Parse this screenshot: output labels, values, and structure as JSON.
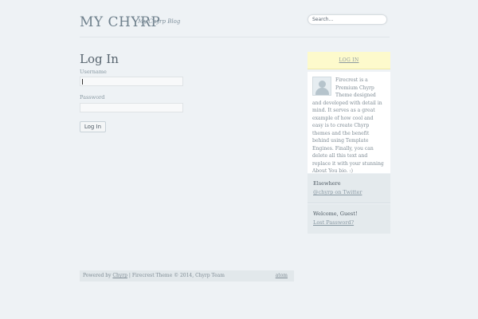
{
  "header": {
    "site_title": "MY CHYRP",
    "site_description": "My Chyrp Blog",
    "search_placeholder": "Search..."
  },
  "main": {
    "title": "Log In",
    "username_label": "Username",
    "username_value": "",
    "password_label": "Password",
    "password_value": "",
    "login_button": "Log In"
  },
  "sidebar": {
    "login_tab": "LOG IN",
    "about_text": "Firecrest is a Premium Chyrp Theme designed and developed with detail in mind. It serves as a great example of how cool and easy is to create Chyrp themes and the benefit behind using Template Engines. Finally, you can delete all this text and replace it with your stunning About You bio. :)",
    "elsewhere_title": "Elsewhere",
    "elsewhere_link": "@chyrp on Twitter",
    "welcome_title": "Welcome, Guest!",
    "lost_password_link": "Lost Password?"
  },
  "footer": {
    "powered_by": "Powered by",
    "chyrp_link": "Chyrp",
    "theme_credit": "| Firecrest Theme © 2014, Chyrp Team",
    "atom_link": "atom"
  }
}
